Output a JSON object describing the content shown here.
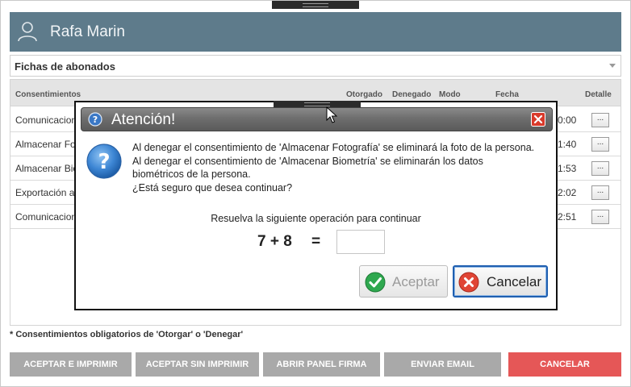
{
  "header": {
    "user_name": "Rafa Marin"
  },
  "selector": {
    "value": "Fichas de abonados"
  },
  "table": {
    "columns": {
      "consentimientos": "Consentimientos",
      "otorgado": "Otorgado",
      "denegado": "Denegado",
      "modo": "Modo",
      "fecha": "Fecha",
      "detalle": "Detalle"
    },
    "rows": [
      {
        "name": "Comunicacion",
        "time": "0:00",
        "detail": "..."
      },
      {
        "name": "Almacenar Fo",
        "time": "1:40",
        "detail": "..."
      },
      {
        "name": "Almacenar Bio",
        "time": "1:53",
        "detail": "..."
      },
      {
        "name": "Exportación a",
        "time": "2:02",
        "detail": "..."
      },
      {
        "name": "Comunicacion",
        "time": "2:51",
        "detail": "..."
      }
    ]
  },
  "footnote": "* Consentimientos obligatorios de 'Otorgar' o 'Denegar'",
  "actions": {
    "accept_print": "ACEPTAR E IMPRIMIR",
    "accept_no_print": "ACEPTAR SIN IMPRIMIR",
    "open_sign_panel": "ABRIR PANEL FIRMA",
    "send_email": "ENVIAR EMAIL",
    "cancel": "CANCELAR"
  },
  "dialog": {
    "title": "Atención!",
    "message_lines": [
      "Al denegar el consentimiento de 'Almacenar Fotografía' se eliminará la foto de la persona.",
      "Al denegar el consentimiento de 'Almacenar Biometría' se eliminarán los datos",
      "biométricos de la persona.",
      "¿Está seguro que desea continuar?"
    ],
    "captcha_prompt": "Resuelva la siguiente operación para continuar",
    "captcha_expression": "7 + 8",
    "captcha_equals": "=",
    "captcha_answer": "",
    "accept_label": "Aceptar",
    "cancel_label": "Cancelar"
  },
  "colors": {
    "header_bg": "#5e7b8b",
    "action_bg": "#a9a9a9",
    "cancel_bg": "#e55757",
    "focus_border": "#1f5fb0"
  }
}
